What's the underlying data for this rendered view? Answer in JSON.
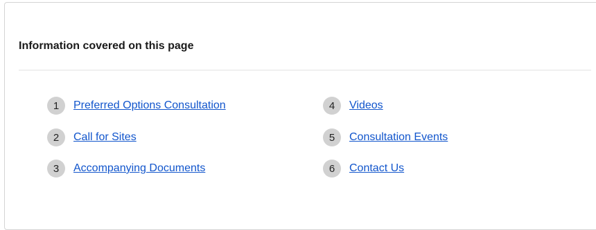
{
  "toc": {
    "title": "Information covered on this page",
    "items": [
      {
        "number": "1",
        "label": "Preferred Options Consultation"
      },
      {
        "number": "2",
        "label": "Call for Sites"
      },
      {
        "number": "3",
        "label": "Accompanying Documents"
      },
      {
        "number": "4",
        "label": "Videos"
      },
      {
        "number": "5",
        "label": "Consultation Events"
      },
      {
        "number": "6",
        "label": "Contact Us"
      }
    ]
  },
  "colors": {
    "link": "#1155cc",
    "badge": "#d1d1d1",
    "border": "#d4d4d4"
  }
}
